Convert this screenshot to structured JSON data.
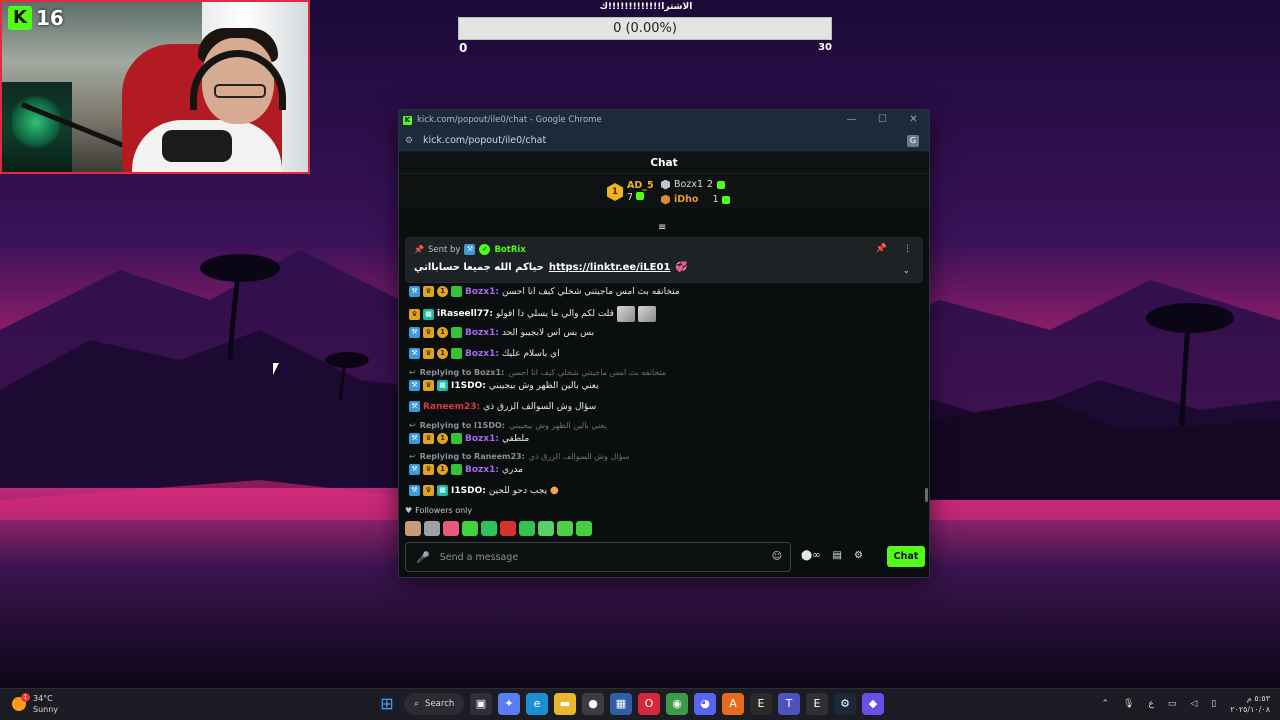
{
  "webcam": {
    "platform_logo": "K",
    "viewer_count": "16"
  },
  "poll": {
    "title": "الاشترا!!!!!!!!!!!!!ك",
    "result": "0 (0.00%)",
    "min": "0",
    "max": "30"
  },
  "window": {
    "title": "kick.com/popout/ile0/chat - Google Chrome",
    "favicon": "K",
    "url": "kick.com/popout/ile0/chat",
    "controls": [
      "—",
      "☐",
      "✕"
    ]
  },
  "chat": {
    "header": "Chat",
    "leaderboard": {
      "first": {
        "rank": "1",
        "name": "AD_5",
        "count": "7"
      },
      "second": {
        "name": "Bozx1",
        "count": "2"
      },
      "third": {
        "name": "iDho",
        "count": "1"
      }
    },
    "pinned": {
      "sent_by_label": "Sent by",
      "sender": "BotRix",
      "text": "حياكم الله جميعا حسابااتي",
      "link": "https://linktr.ee/iLE01"
    },
    "messages": [
      {
        "user": "Bozx1:",
        "text": "متخانقه بث امس ماجيتني شخلي كيف انا احسن"
      },
      {
        "user": "iRaseell77:",
        "text": "قلت لكم والي ما يسلي ذا افولو"
      },
      {
        "user": "Bozx1:",
        "text": "بس بس اس لابجيبو الحد"
      },
      {
        "user": "Bozx1:",
        "text": "اي باسلام عليك"
      },
      {
        "reply_label": "Replying to Bozx1:",
        "reply_text": "متخانقه بث امس ماجيتني شخلي كيف انا احسن"
      },
      {
        "user": "I1SDO:",
        "text": "يعني بالين الظهر وش بيجيبني"
      },
      {
        "user": "Raneem23:",
        "text": "سؤال وش السوالف الزرق ذي"
      },
      {
        "reply_label": "Replying to I1SDO:",
        "reply_text": "يعني بالين الظهر وش بيجيبني"
      },
      {
        "user": "Bozx1:",
        "text": "ملطفي"
      },
      {
        "reply_label": "Replying to Raneem23:",
        "reply_text": "سؤال وش السوالف الزرق ذي"
      },
      {
        "user": "Bozx1:",
        "text": "مدري"
      },
      {
        "user": "I1SDO:",
        "text": "يجب دحو للحين"
      }
    ],
    "followers_only": "Followers only",
    "input_placeholder": "Send a message",
    "send_button": "Chat"
  },
  "taskbar": {
    "weather": {
      "temp": "34°C",
      "condition": "Sunny"
    },
    "search_label": "Search",
    "clock_time": "٥:٥٣ م",
    "clock_date": "٢٠٢٥/١٠/٠٨",
    "lang": "ع"
  }
}
